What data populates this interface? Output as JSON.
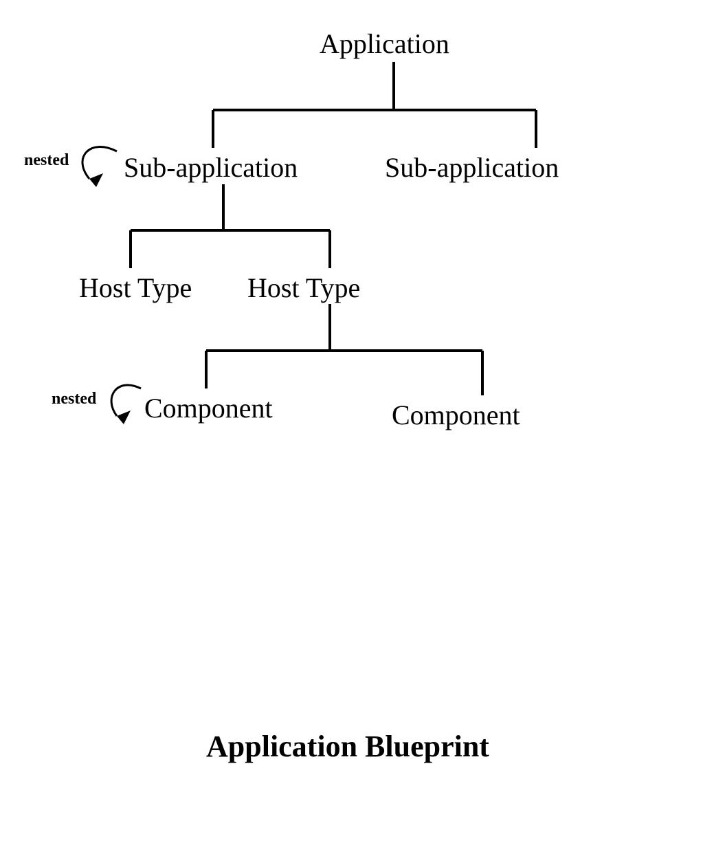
{
  "nodes": {
    "application": "Application",
    "subapp1": "Sub-application",
    "subapp2": "Sub-application",
    "hosttype1": "Host Type",
    "hosttype2": "Host Type",
    "component1": "Component",
    "component2": "Component"
  },
  "labels": {
    "nested1": "nested",
    "nested2": "nested"
  },
  "title": "Application Blueprint"
}
